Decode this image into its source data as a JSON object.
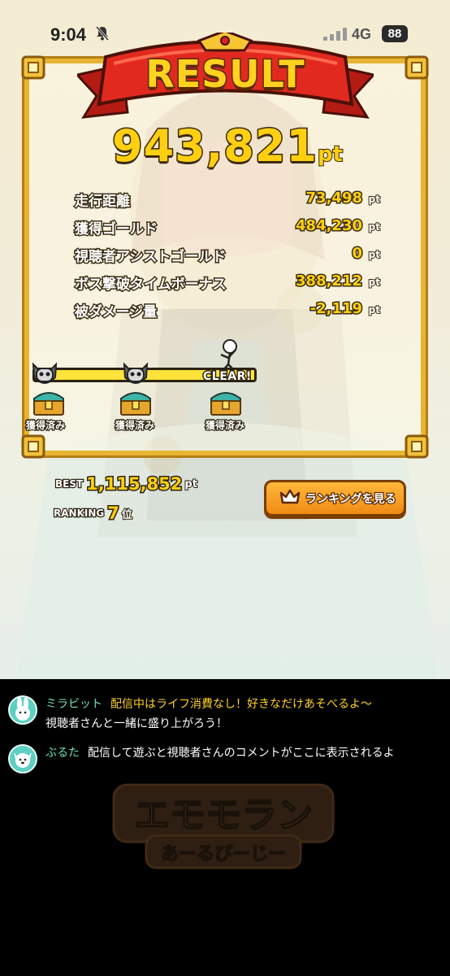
{
  "status_bar": {
    "time": "9:04",
    "network": "4G",
    "battery": "88"
  },
  "result": {
    "title": "RESULT",
    "total_score": "943,821",
    "total_unit": "pt",
    "stats": [
      {
        "label": "走行距離",
        "value": "73,498",
        "unit": "pt"
      },
      {
        "label": "獲得ゴールド",
        "value": "484,230",
        "unit": "pt"
      },
      {
        "label": "視聴者アシストゴールド",
        "value": "0",
        "unit": "pt"
      },
      {
        "label": "ボス撃破タイムボーナス",
        "value": "388,212",
        "unit": "pt"
      },
      {
        "label": "被ダメージ量",
        "value": "-2,119",
        "unit": "pt"
      }
    ],
    "checkpoints": [
      {
        "label": "獲得済み"
      },
      {
        "label": "獲得済み"
      },
      {
        "label": "獲得済み"
      }
    ],
    "clear_label": "CLEAR!"
  },
  "records": {
    "best_label": "BEST",
    "best_value": "1,115,852",
    "best_unit": "pt",
    "ranking_label": "RANKING",
    "ranking_value": "7",
    "ranking_unit": "位",
    "ranking_button": "ランキングを見る"
  },
  "chat": [
    {
      "name": "ミラビット",
      "text_line1": "配信中はライフ消費なし！好きなだけあそべるよ〜",
      "text_line2": "視聴者さんと一緒に盛り上がろう！"
    },
    {
      "name": "ぶるた",
      "text_line1": "配信して遊ぶと視聴者さんのコメントがここに表示されるよ"
    }
  ],
  "logo": {
    "line1": "エモモラン",
    "line2": "あーるぴーじー"
  },
  "colors": {
    "gold": "#ffcf10",
    "frame": "#e7b531",
    "banner_red": "#d8231c",
    "button_orange": "#f08a14",
    "chat_name": "#6fe3c4",
    "chat_highlight": "#ffd21f"
  }
}
